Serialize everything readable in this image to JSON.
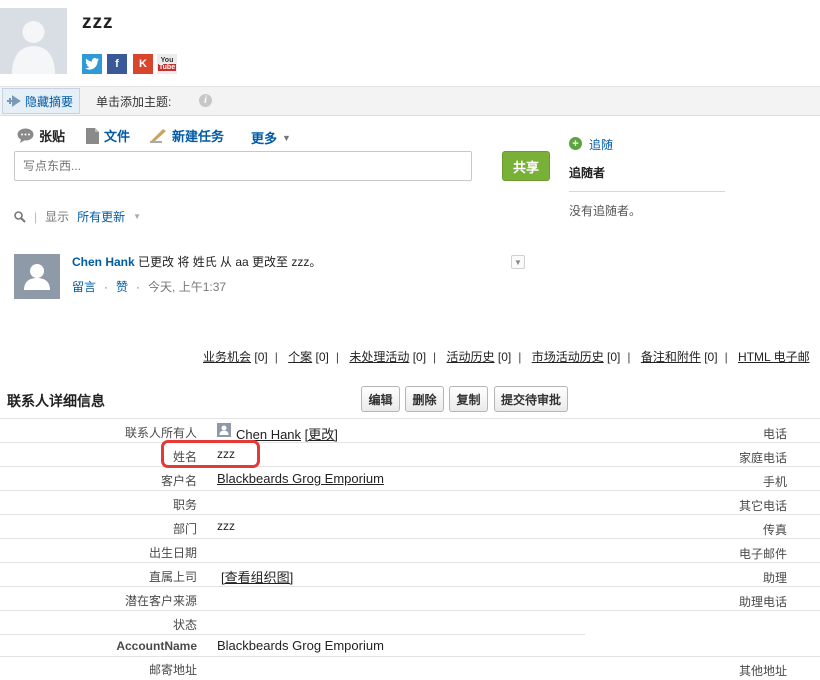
{
  "header": {
    "contact_name": "zzz",
    "social": {
      "twitter": "t",
      "facebook": "f",
      "klout": "K",
      "youtube_1": "You",
      "youtube_2": "Tube"
    }
  },
  "topic_bar": {
    "hide_summary": "隐藏摘要",
    "add_topic": "单击添加主题:",
    "info": "i"
  },
  "publisher": {
    "post": "张贴",
    "file": "文件",
    "new_task": "新建任务",
    "more": "更多",
    "input_placeholder": "写点东西...",
    "share": "共享"
  },
  "followers": {
    "follow": "追随",
    "title": "追随者",
    "none": "没有追随者。"
  },
  "filter": {
    "show": "显示",
    "all_updates": "所有更新"
  },
  "feed": {
    "author": "Chen Hank",
    "text": " 已更改 将 姓氏 从 aa 更改至 zzz。",
    "comment": "留言",
    "like": "赞",
    "dot": "·",
    "time": "今天, 上午1:37"
  },
  "related_links": [
    {
      "label": "业务机会",
      "count": "[0]"
    },
    {
      "label": "个案",
      "count": "[0]"
    },
    {
      "label": "未处理活动",
      "count": "[0]"
    },
    {
      "label": "活动历史",
      "count": "[0]"
    },
    {
      "label": "市场活动历史",
      "count": "[0]"
    },
    {
      "label": "备注和附件",
      "count": "[0]"
    },
    {
      "label": "HTML 电子邮",
      "count": ""
    }
  ],
  "detail": {
    "title": "联系人详细信息",
    "buttons": {
      "edit": "编辑",
      "delete": "删除",
      "copy": "复制",
      "submit": "提交待审批"
    },
    "owner_label": "联系人所有人",
    "owner_value": "Chen Hank",
    "owner_change": "[更改]",
    "name_label": "姓名",
    "name_value": "zzz",
    "account_label": "客户名",
    "account_value": "Blackbeards Grog Emporium",
    "title_label": "职务",
    "department_label": "部门",
    "department_value": "zzz",
    "birthdate_label": "出生日期",
    "reports_to_label": "直属上司",
    "org_chart": "[查看组织图]",
    "lead_source_label": "潜在客户来源",
    "status_label": "状态",
    "accountname_label": "AccountName",
    "accountname_value": "Blackbeards Grog Emporium",
    "mailing_label": "邮寄地址",
    "right": {
      "phone": "电话",
      "home_phone": "家庭电话",
      "mobile": "手机",
      "other_phone": "其它电话",
      "fax": "传真",
      "email": "电子邮件",
      "assistant": "助理",
      "assistant_phone": "助理电话",
      "other_address": "其他地址"
    }
  }
}
